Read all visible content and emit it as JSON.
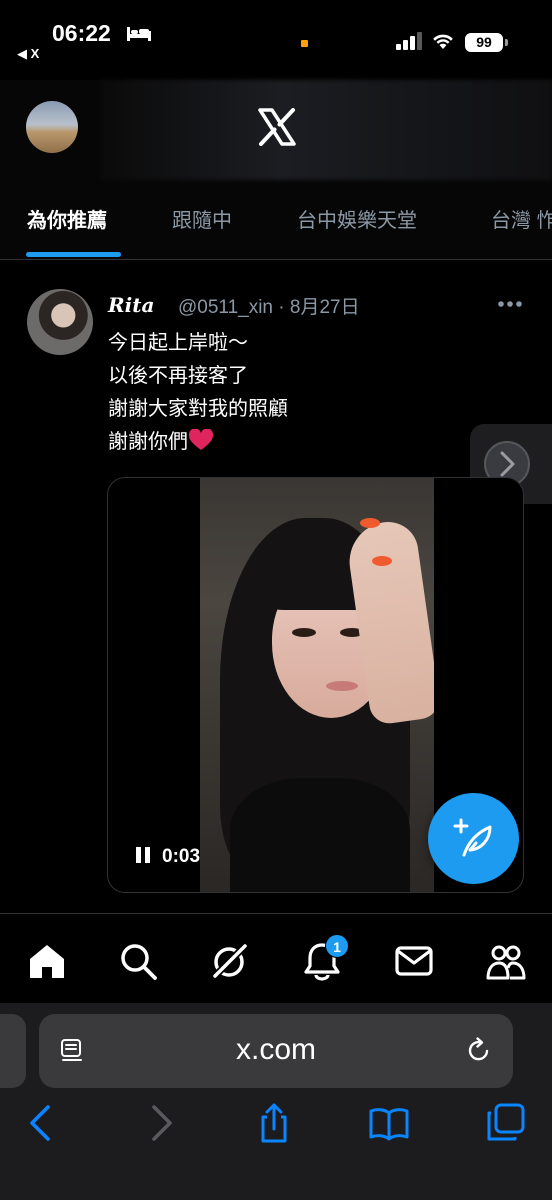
{
  "status_bar": {
    "time": "06:22",
    "back_app": "◀ X",
    "battery": "99"
  },
  "header": {
    "logo": "X",
    "tabs": [
      "為你推薦",
      "跟隨中",
      "台中娛樂天堂",
      "台灣 怍"
    ]
  },
  "tweet": {
    "display_name": "Rita",
    "handle_date": "@0511_xin · 8月27日",
    "lines": [
      "今日起上岸啦～",
      "以後不再接客了",
      "謝謝大家對我的照顧",
      "謝謝你們"
    ],
    "video_time": "0:03"
  },
  "bottom_nav": {
    "items": [
      "home-icon",
      "search-icon",
      "grok-icon",
      "notifications-icon",
      "messages-icon",
      "communities-icon"
    ],
    "notification_count": "1"
  },
  "browser": {
    "url": "x.com"
  },
  "colors": {
    "accent": "#1d9bf0",
    "background": "#000000",
    "heart": "#e0245e"
  }
}
